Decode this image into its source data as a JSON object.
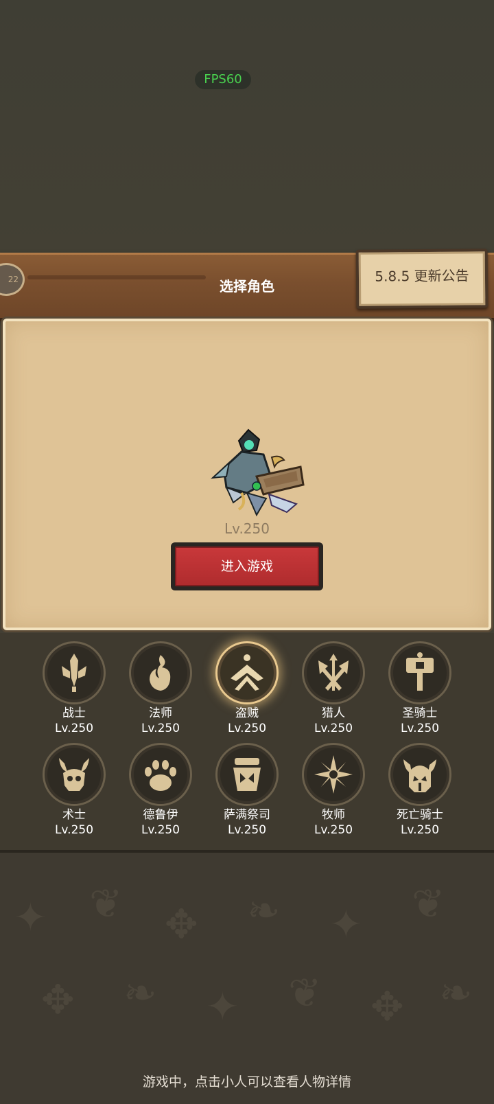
{
  "status": {
    "fps": "FPS60"
  },
  "header": {
    "title": "选择角色",
    "avatar_level": "22",
    "notice_button": "5.8.5 更新公告"
  },
  "hero": {
    "level": "Lv.250"
  },
  "enter_button": "进入游戏",
  "classes": [
    {
      "name": "战士",
      "level": "Lv.250"
    },
    {
      "name": "法师",
      "level": "Lv.250"
    },
    {
      "name": "盗贼",
      "level": "Lv.250",
      "selected": true
    },
    {
      "name": "猎人",
      "level": "Lv.250"
    },
    {
      "name": "圣骑士",
      "level": "Lv.250"
    },
    {
      "name": "术士",
      "level": "Lv.250"
    },
    {
      "name": "德鲁伊",
      "level": "Lv.250"
    },
    {
      "name": "萨满祭司",
      "level": "Lv.250"
    },
    {
      "name": "牧师",
      "level": "Lv.250"
    },
    {
      "name": "死亡骑士",
      "level": "Lv.250"
    }
  ],
  "footer": {
    "hint": "游戏中，点击小人可以查看人物详情"
  },
  "colors": {
    "accent_red": "#c8383a",
    "icon_gold": "#d9c49a",
    "panel": "#dfc396"
  }
}
